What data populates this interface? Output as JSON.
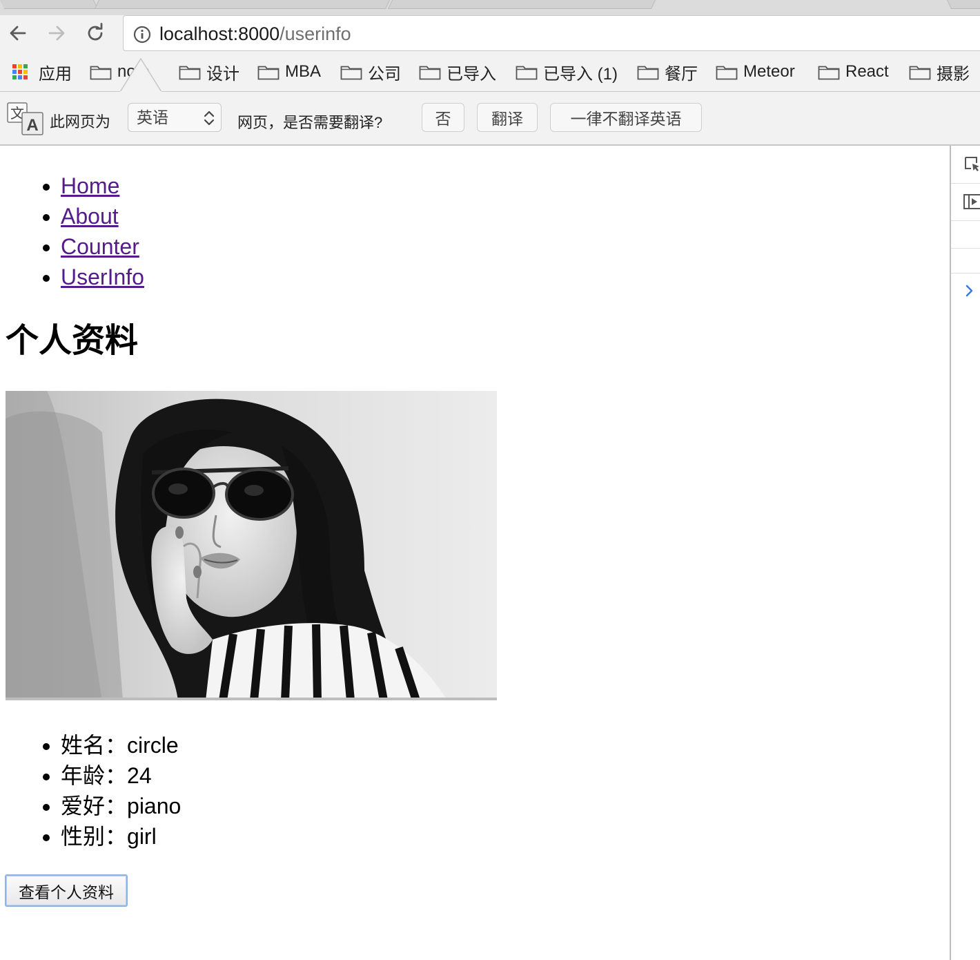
{
  "browser": {
    "url_host": "localhost:8000",
    "url_path": "/userinfo"
  },
  "bookmarks": [
    {
      "label": "应用",
      "icon": "apps-grid-icon"
    },
    {
      "label": "no   e",
      "icon": "folder-icon"
    },
    {
      "label": "设计",
      "icon": "folder-icon"
    },
    {
      "label": "MBA",
      "icon": "folder-icon"
    },
    {
      "label": "公司",
      "icon": "folder-icon"
    },
    {
      "label": "已导入",
      "icon": "folder-icon"
    },
    {
      "label": "已导入 (1)",
      "icon": "folder-icon"
    },
    {
      "label": "餐厅",
      "icon": "folder-icon"
    },
    {
      "label": "Meteor",
      "icon": "folder-icon"
    },
    {
      "label": "React",
      "icon": "folder-icon"
    },
    {
      "label": "摄影",
      "icon": "folder-icon"
    }
  ],
  "translate": {
    "label": "此网页为",
    "language": "英语",
    "question": "网页，是否需要翻译?",
    "no_button": "否",
    "translate_button": "翻译",
    "never_button": "一律不翻译英语"
  },
  "nav": [
    {
      "label": "Home"
    },
    {
      "label": "About"
    },
    {
      "label": "Counter"
    },
    {
      "label": "UserInfo"
    }
  ],
  "page": {
    "title": "个人资料",
    "info": [
      {
        "key": "姓名：",
        "value": "circle"
      },
      {
        "key": "年龄：",
        "value": "24"
      },
      {
        "key": "爱好：",
        "value": "piano"
      },
      {
        "key": "性别：",
        "value": "girl"
      }
    ],
    "button_label": "查看个人资料"
  },
  "colors": {
    "link_visited": "#551a8b",
    "chrome_bg": "#f2f2f2",
    "button_focus": "#8fb3e6"
  }
}
